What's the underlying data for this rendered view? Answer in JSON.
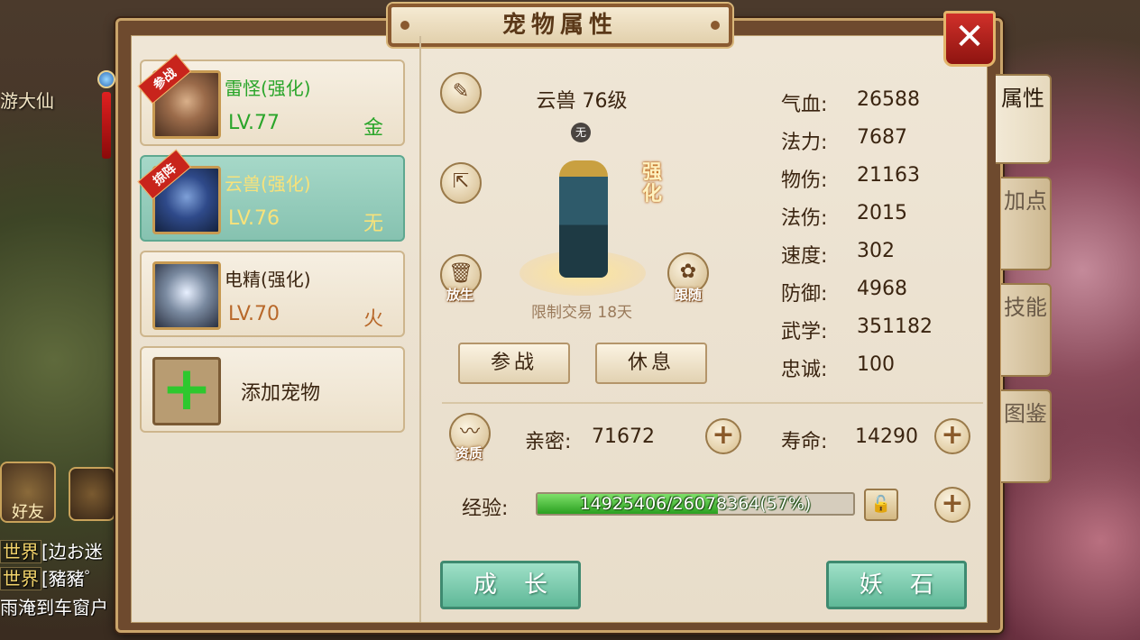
{
  "scene": {
    "npc_name": "游大仙",
    "friend_label": "好友",
    "chat_lines": [
      {
        "tag": "世界",
        "text": "[边お迷"
      },
      {
        "tag": "世界",
        "text": "[豬豬゜"
      },
      {
        "tag": "",
        "text": "雨淹到车窗户"
      }
    ]
  },
  "window": {
    "title": "宠物属性",
    "close_label": "✕"
  },
  "pets": [
    {
      "name": "雷怪(强化)",
      "level": "LV.77",
      "element": "金",
      "badge": "参战",
      "selected": false
    },
    {
      "name": "云兽(强化)",
      "level": "LV.76",
      "element": "无",
      "badge": "掠阵",
      "selected": true
    },
    {
      "name": "电精(强化)",
      "level": "LV.70",
      "element": "火",
      "badge": "",
      "selected": false
    }
  ],
  "add_pet": {
    "label": "添加宠物",
    "icon": "+"
  },
  "detail": {
    "title": "云兽 76级",
    "element_badge": "无",
    "enhanced_label": "强化",
    "trade_limit": "限制交易 18天",
    "release_label": "放生",
    "follow_label": "跟随",
    "battle_button": "参战",
    "rest_button": "休息",
    "icons": {
      "rename": "pencil-icon",
      "share": "share-icon",
      "release": "trash-icon",
      "follow": "paw-icon",
      "aptitude": "pulse-icon"
    }
  },
  "stats": [
    {
      "label": "气血:",
      "value": "26588"
    },
    {
      "label": "法力:",
      "value": "7687"
    },
    {
      "label": "物伤:",
      "value": "21163"
    },
    {
      "label": "法伤:",
      "value": "2015"
    },
    {
      "label": "速度:",
      "value": "302"
    },
    {
      "label": "防御:",
      "value": "4968"
    },
    {
      "label": "武学:",
      "value": "351182"
    },
    {
      "label": "忠诚:",
      "value": "100"
    }
  ],
  "tabs": [
    {
      "label": "属性",
      "active": true
    },
    {
      "label": "加点",
      "active": false
    },
    {
      "label": "技能",
      "active": false
    },
    {
      "label": "图鉴",
      "active": false
    }
  ],
  "bottom": {
    "aptitude_label": "资质",
    "intimacy_label": "亲密:",
    "intimacy_value": "71672",
    "lifespan_label": "寿命:",
    "lifespan_value": "14290",
    "exp_label": "经验:",
    "exp_text": "14925406/26078364(57%)",
    "exp_fraction": 0.57,
    "grow_button": "成长",
    "stone_button": "妖石"
  },
  "colors": {
    "frame": "#6e4a2e",
    "panel": "#efe6d6",
    "accent_green": "#2aa52a",
    "selected_card": "#a6d8c8",
    "close_red": "#d0302a"
  }
}
